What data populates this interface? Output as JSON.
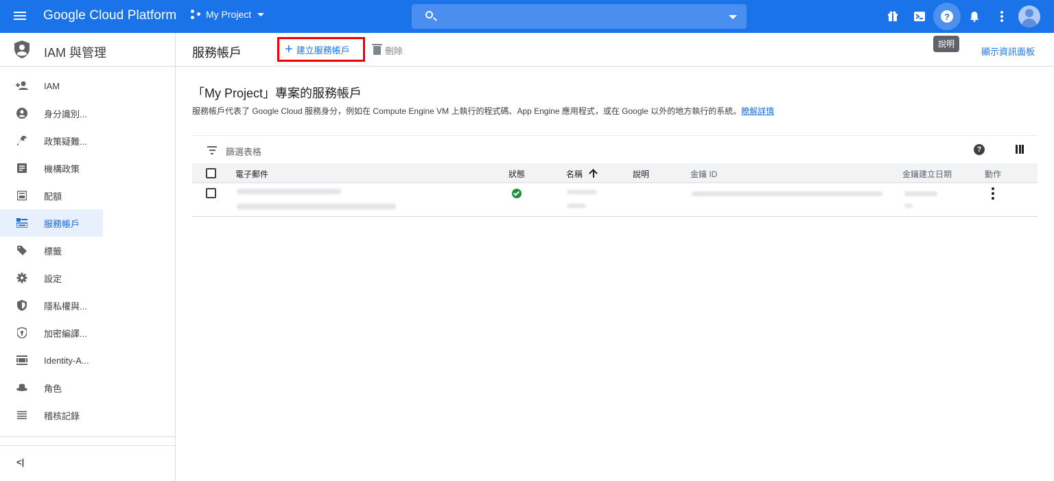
{
  "topbar": {
    "brand": "Google Cloud Platform",
    "project_name": "My Project",
    "search_placeholder": "",
    "tooltip": "說明"
  },
  "sidebar": {
    "title": "IAM 與管理",
    "items": [
      {
        "label": "IAM",
        "icon": "person-add-icon"
      },
      {
        "label": "身分識別...",
        "icon": "account-circle-icon"
      },
      {
        "label": "政策疑難...",
        "icon": "wrench-icon"
      },
      {
        "label": "機構政策",
        "icon": "document-list-icon"
      },
      {
        "label": "配額",
        "icon": "quota-icon"
      },
      {
        "label": "服務帳戶",
        "icon": "service-account-icon",
        "active": true
      },
      {
        "label": "標籤",
        "icon": "tag-icon"
      },
      {
        "label": "設定",
        "icon": "gear-icon"
      },
      {
        "label": "隱私權與...",
        "icon": "privacy-shield-icon"
      },
      {
        "label": "加密編譯...",
        "icon": "encryption-shield-icon"
      },
      {
        "label": "Identity-A...",
        "icon": "identity-aware-icon"
      },
      {
        "label": "角色",
        "icon": "hat-icon"
      },
      {
        "label": "稽核記錄",
        "icon": "list-lines-icon"
      }
    ],
    "collapse_label": "<|"
  },
  "actionbar": {
    "title": "服務帳戶",
    "create_label": "建立服務帳戶",
    "delete_label": "刪除",
    "info_panel_label": "顯示資訊面板"
  },
  "section": {
    "title": "「My Project」專案的服務帳戶",
    "description": "服務帳戶代表了 Google Cloud 服務身分，例如在 Compute Engine VM 上執行的程式碼、App Engine 應用程式，或在 Google 以外的地方執行的系統。",
    "learn_more": "瞭解詳情"
  },
  "filter": {
    "placeholder": "篩選表格"
  },
  "table": {
    "columns": [
      "電子郵件",
      "狀態",
      "名稱",
      "說明",
      "金鑰 ID",
      "金鑰建立日期",
      "動作"
    ],
    "sort_column": "名稱",
    "rows": [
      {
        "email": "(redacted)",
        "status": "enabled",
        "name": "(redacted)",
        "description": "",
        "key_id": "(redacted)",
        "key_created": "(redacted)"
      }
    ]
  },
  "colors": {
    "topbar": "#1a73e8",
    "accent": "#1a73e8",
    "highlight_border": "#ee0000",
    "status_ok": "#1e8e3e"
  }
}
